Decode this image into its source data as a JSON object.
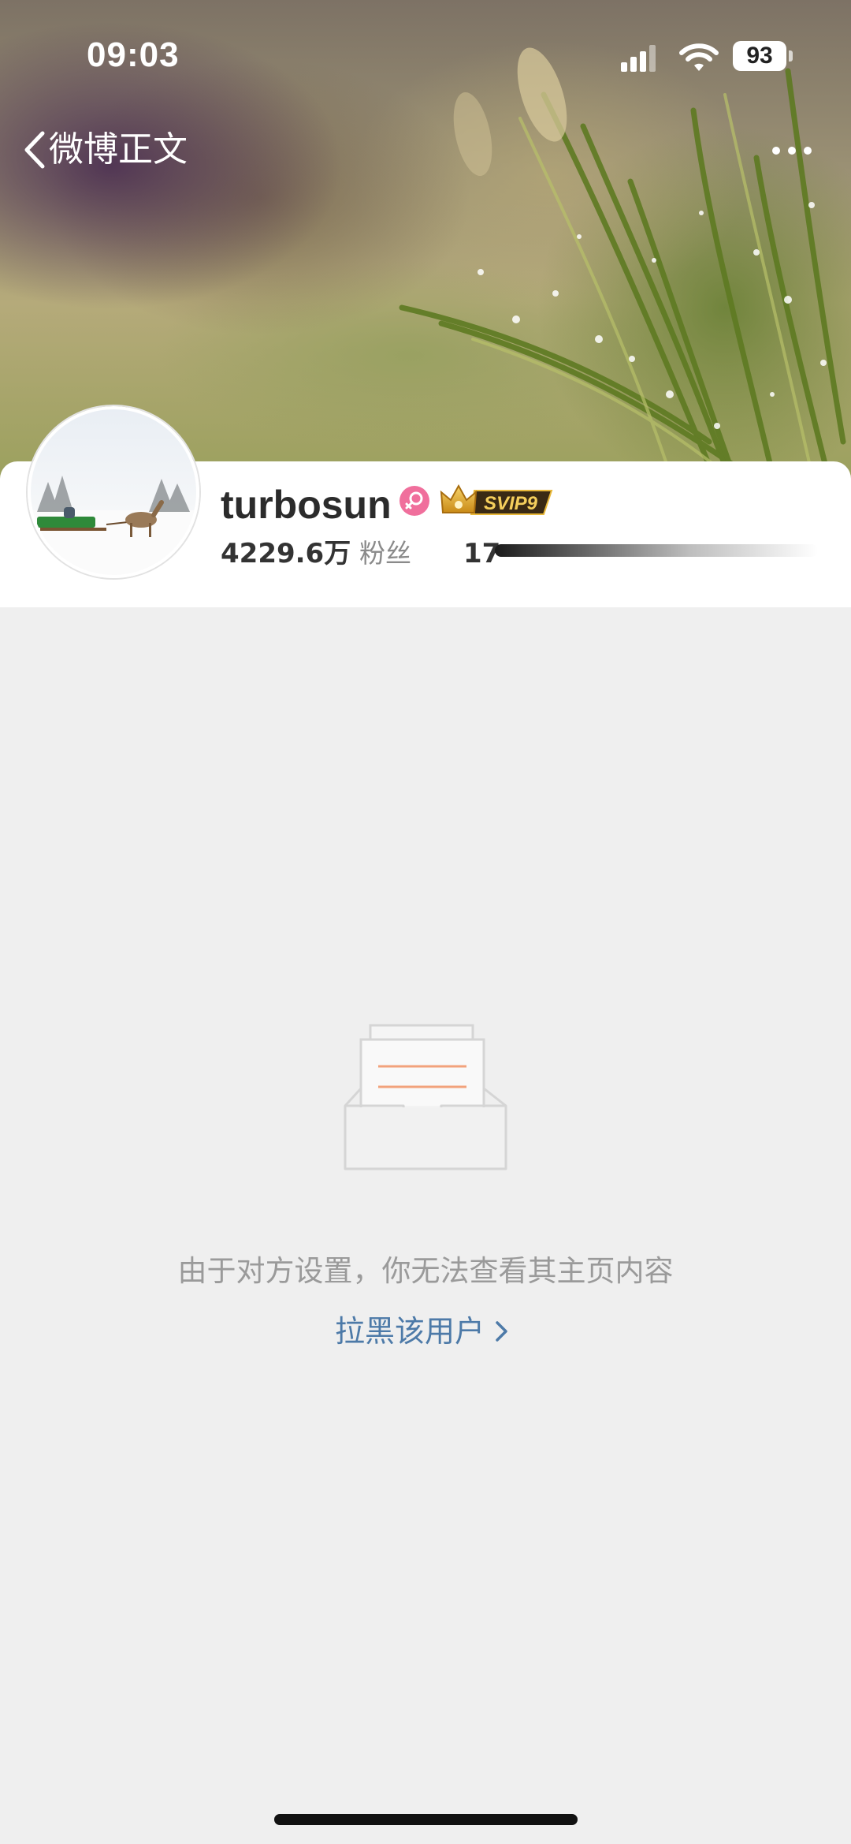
{
  "status_bar": {
    "time": "09:03",
    "battery": "93"
  },
  "nav": {
    "back_label": "微博正文",
    "back_icon": "chevron-left-icon",
    "more_icon": "more-dots-icon"
  },
  "profile": {
    "username": "turbosun",
    "gender_icon": "female-icon",
    "vip_badge": "SVIP9",
    "fans_count": "4229.6万",
    "fans_label": "粉丝",
    "follow_count_visible": "17"
  },
  "empty_state": {
    "icon": "empty-inbox-icon",
    "message": "由于对方设置，你无法查看其主页内容",
    "block_link": "拉黑该用户"
  },
  "colors": {
    "link": "#4d7aa8",
    "background": "#efefef",
    "gender_badge": "#f06f9c",
    "svip_gold": "#d9a421"
  }
}
